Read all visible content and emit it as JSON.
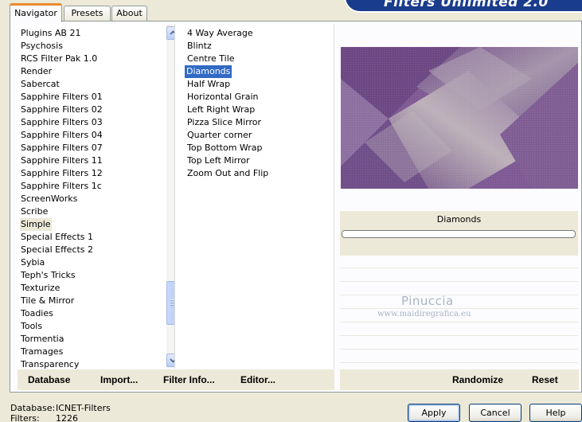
{
  "app": {
    "banner_title": "Filters Unlimited 2.0"
  },
  "tabs": [
    {
      "label": "Navigator",
      "active": true
    },
    {
      "label": "Presets",
      "active": false
    },
    {
      "label": "About",
      "active": false
    }
  ],
  "categories": {
    "items": [
      "Plugins AB 21",
      "Psychosis",
      "RCS Filter Pak 1.0",
      "Render",
      "Sabercat",
      "Sapphire Filters 01",
      "Sapphire Filters 02",
      "Sapphire Filters 03",
      "Sapphire Filters 04",
      "Sapphire Filters 07",
      "Sapphire Filters 11",
      "Sapphire Filters 12",
      "Sapphire Filters 1c",
      "ScreenWorks",
      "Scribe",
      "Simple",
      "Special Effects 1",
      "Special Effects 2",
      "Sybia",
      "Teph's Tricks",
      "Texturize",
      "Tile & Mirror",
      "Toadies",
      "Tools",
      "Tormentia",
      "Tramages",
      "Transparency"
    ],
    "selected": "Simple"
  },
  "filters": {
    "items": [
      "4 Way Average",
      "Blintz",
      "Centre Tile",
      "Diamonds",
      "Half Wrap",
      "Horizontal Grain",
      "Left Right Wrap",
      "Pizza Slice Mirror",
      "Quarter corner",
      "Top Bottom Wrap",
      "Top Left Mirror",
      "Zoom Out and Flip"
    ],
    "selected": "Diamonds"
  },
  "preview": {
    "filter_name": "Diamonds",
    "progress": 0
  },
  "left_buttons": {
    "database": "Database",
    "import": "Import...",
    "filter_info": "Filter Info...",
    "editor": "Editor..."
  },
  "right_buttons": {
    "randomize": "Randomize",
    "reset": "Reset"
  },
  "watermark": {
    "name": "Pinuccia",
    "site": "www.maidiregrafica.eu"
  },
  "status": {
    "database_label": "Database:",
    "database_value": "ICNET-Filters",
    "filters_label": "Filters:",
    "filters_value": "1226"
  },
  "dialog": {
    "apply": "Apply",
    "cancel": "Cancel",
    "help": "Help"
  },
  "colors": {
    "accent": "#316ac5",
    "banner": "#1a3c8c",
    "preview": "#7d5893"
  },
  "icons": {
    "scroll_up": "chevron-up-icon",
    "scroll_down": "chevron-down-icon"
  }
}
